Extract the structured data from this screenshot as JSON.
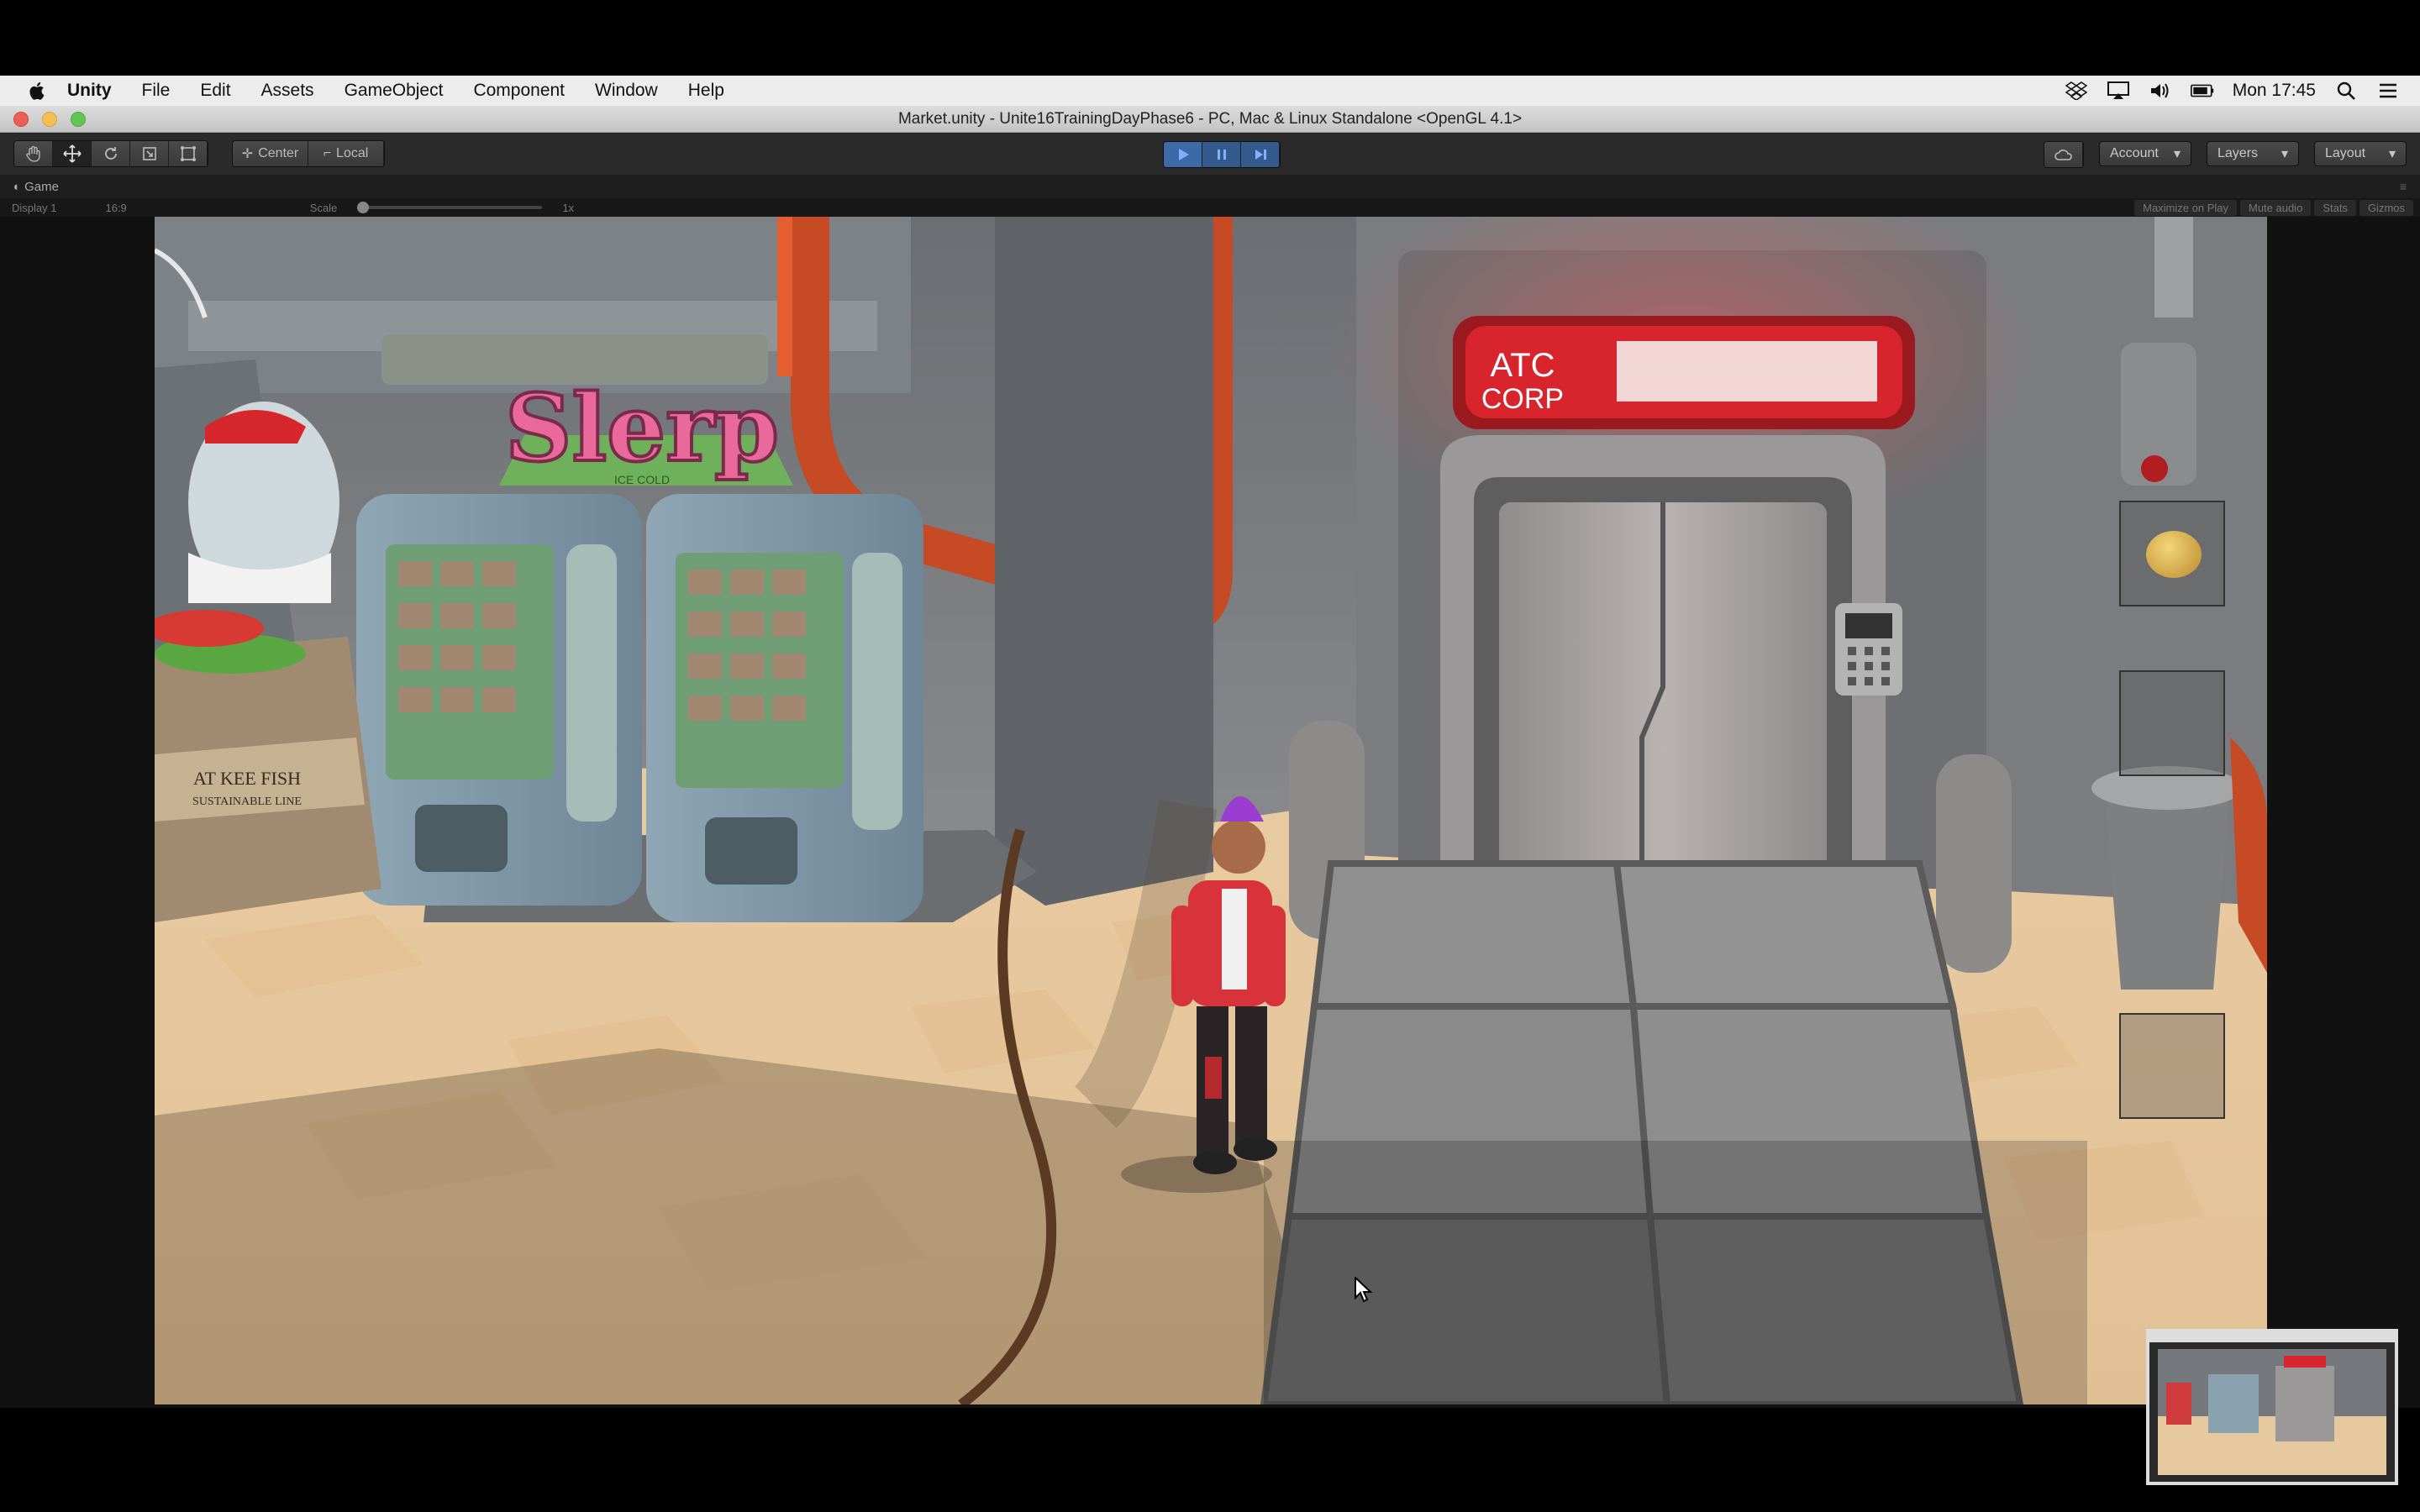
{
  "menubar": {
    "app_name": "Unity",
    "items": [
      "File",
      "Edit",
      "Assets",
      "GameObject",
      "Component",
      "Window",
      "Help"
    ],
    "clock": "Mon 17:45"
  },
  "window": {
    "title": "Market.unity - Unite16TrainingDayPhase6 - PC, Mac & Linux Standalone <OpenGL 4.1>"
  },
  "toolbar": {
    "pivot_label": "Center",
    "space_label": "Local",
    "account_label": "Account",
    "layers_label": "Layers",
    "layout_label": "Layout"
  },
  "game_tab": {
    "label": "Game",
    "display": "Display 1",
    "aspect": "16:9",
    "scale_label": "Scale",
    "scale_value": "1x",
    "maximize_on_play": "Maximize on Play",
    "mute_audio": "Mute audio",
    "stats": "Stats",
    "gizmos": "Gizmos"
  },
  "scene": {
    "sign_brand": "Slerp",
    "sign_tagline": "ICE COLD",
    "corp_sign_top": "ATC",
    "corp_sign_bottom": "CORP",
    "shop_sign_line1": "AT KEE FISH",
    "shop_sign_line2": "SUSTAINABLE LINE"
  },
  "colors": {
    "accent_play": "#3c6aa6",
    "corp_red": "#d8242c",
    "floor_sand": "#e8caa0"
  }
}
